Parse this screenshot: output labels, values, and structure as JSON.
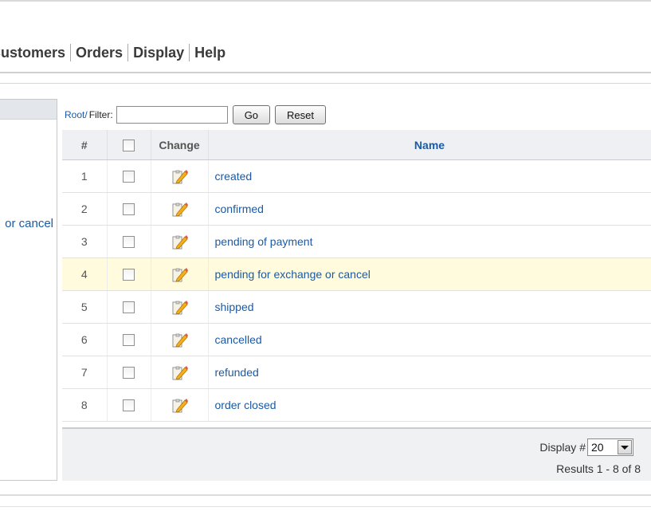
{
  "menu": {
    "items": [
      {
        "label": "Customers"
      },
      {
        "label": "Orders"
      },
      {
        "label": "Display"
      },
      {
        "label": "Help"
      }
    ]
  },
  "sidebar": {
    "visible_text": "or cancel"
  },
  "filter": {
    "root_label": "Root/",
    "filter_label": "Filter:",
    "value": "",
    "go_label": "Go",
    "reset_label": "Reset"
  },
  "table": {
    "columns": {
      "num": "#",
      "change": "Change",
      "name": "Name"
    },
    "rows": [
      {
        "num": "1",
        "name": "created"
      },
      {
        "num": "2",
        "name": "confirmed"
      },
      {
        "num": "3",
        "name": "pending of payment"
      },
      {
        "num": "4",
        "name": "pending for exchange or cancel"
      },
      {
        "num": "5",
        "name": "shipped"
      },
      {
        "num": "6",
        "name": "cancelled"
      },
      {
        "num": "7",
        "name": "refunded"
      },
      {
        "num": "8",
        "name": "order closed"
      }
    ],
    "highlighted_row": 4,
    "icons": {
      "row_edit": "edit-icon",
      "select": "checkbox"
    }
  },
  "footer": {
    "display_label": "Display #",
    "display_value": "20",
    "results_text": "Results 1 - 8 of 8"
  },
  "colors": {
    "link": "#1a5aa6",
    "highlight_row": "#fffbdc",
    "header_bg": "#eef0f3"
  }
}
